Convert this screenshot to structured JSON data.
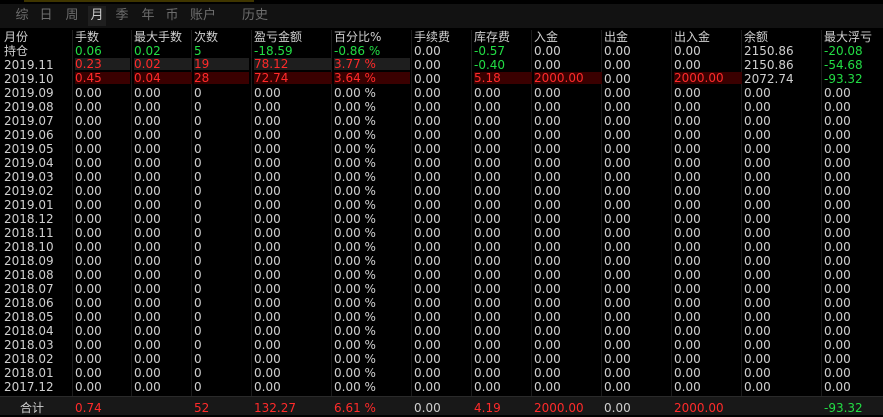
{
  "tabs": [
    {
      "label": "综",
      "active": false
    },
    {
      "label": "日",
      "active": false
    },
    {
      "label": "周",
      "active": false
    },
    {
      "label": "月",
      "active": true
    },
    {
      "label": "季",
      "active": false
    },
    {
      "label": "年",
      "active": false
    },
    {
      "label": "币",
      "active": false
    },
    {
      "label": "账户",
      "active": false
    },
    {
      "label": "历史",
      "active": false
    }
  ],
  "columns": [
    "月份",
    "手数",
    "最大手数",
    "次数",
    "盈亏金额",
    "百分比%",
    "手续费",
    "库存费",
    "入金",
    "出金",
    "出入金",
    "余额",
    "最大浮亏"
  ],
  "colors": {
    "up": "#ff2a2a",
    "down": "#22dd44",
    "neutral": "#d0d0d0",
    "red_bg": "#3a0000",
    "grey_bg": "#1e1e1e"
  },
  "rows": [
    {
      "cells": [
        "持仓",
        "0.06",
        "0.02",
        "5",
        "-18.59",
        "-0.86 %",
        "0.00",
        "-0.57",
        "0.00",
        "0.00",
        "0.00",
        "2150.86",
        "-20.08"
      ],
      "colors": [
        "n",
        "g",
        "g",
        "g",
        "g",
        "g",
        "n",
        "g",
        "n",
        "n",
        "n",
        "n",
        "g"
      ],
      "bars": {}
    },
    {
      "cells": [
        "2019.11",
        "0.23",
        "0.02",
        "19",
        "78.12",
        "3.77 %",
        "0.00",
        "-0.40",
        "0.00",
        "0.00",
        "0.00",
        "2150.86",
        "-54.68"
      ],
      "colors": [
        "n",
        "r",
        "r",
        "r",
        "r",
        "r",
        "n",
        "g",
        "n",
        "n",
        "n",
        "n",
        "g"
      ],
      "bars": {
        "1": "grey",
        "2": "grey",
        "3": "grey",
        "4": "grey",
        "5": "grey"
      }
    },
    {
      "cells": [
        "2019.10",
        "0.45",
        "0.04",
        "28",
        "72.74",
        "3.64 %",
        "0.00",
        "5.18",
        "2000.00",
        "0.00",
        "2000.00",
        "2072.74",
        "-93.32"
      ],
      "colors": [
        "n",
        "r",
        "r",
        "r",
        "r",
        "r",
        "n",
        "r",
        "r",
        "n",
        "r",
        "n",
        "g"
      ],
      "bars": {
        "1": "red",
        "2": "red",
        "3": "red",
        "4": "red",
        "5": "red",
        "7": "red",
        "8": "red",
        "10": "red"
      }
    },
    {
      "cells": [
        "2019.09",
        "0.00",
        "0.00",
        "0",
        "0.00",
        "0.00 %",
        "0.00",
        "0.00",
        "0.00",
        "0.00",
        "0.00",
        "0.00",
        "0.00"
      ]
    },
    {
      "cells": [
        "2019.08",
        "0.00",
        "0.00",
        "0",
        "0.00",
        "0.00 %",
        "0.00",
        "0.00",
        "0.00",
        "0.00",
        "0.00",
        "0.00",
        "0.00"
      ]
    },
    {
      "cells": [
        "2019.07",
        "0.00",
        "0.00",
        "0",
        "0.00",
        "0.00 %",
        "0.00",
        "0.00",
        "0.00",
        "0.00",
        "0.00",
        "0.00",
        "0.00"
      ]
    },
    {
      "cells": [
        "2019.06",
        "0.00",
        "0.00",
        "0",
        "0.00",
        "0.00 %",
        "0.00",
        "0.00",
        "0.00",
        "0.00",
        "0.00",
        "0.00",
        "0.00"
      ]
    },
    {
      "cells": [
        "2019.05",
        "0.00",
        "0.00",
        "0",
        "0.00",
        "0.00 %",
        "0.00",
        "0.00",
        "0.00",
        "0.00",
        "0.00",
        "0.00",
        "0.00"
      ]
    },
    {
      "cells": [
        "2019.04",
        "0.00",
        "0.00",
        "0",
        "0.00",
        "0.00 %",
        "0.00",
        "0.00",
        "0.00",
        "0.00",
        "0.00",
        "0.00",
        "0.00"
      ]
    },
    {
      "cells": [
        "2019.03",
        "0.00",
        "0.00",
        "0",
        "0.00",
        "0.00 %",
        "0.00",
        "0.00",
        "0.00",
        "0.00",
        "0.00",
        "0.00",
        "0.00"
      ]
    },
    {
      "cells": [
        "2019.02",
        "0.00",
        "0.00",
        "0",
        "0.00",
        "0.00 %",
        "0.00",
        "0.00",
        "0.00",
        "0.00",
        "0.00",
        "0.00",
        "0.00"
      ]
    },
    {
      "cells": [
        "2019.01",
        "0.00",
        "0.00",
        "0",
        "0.00",
        "0.00 %",
        "0.00",
        "0.00",
        "0.00",
        "0.00",
        "0.00",
        "0.00",
        "0.00"
      ]
    },
    {
      "cells": [
        "2018.12",
        "0.00",
        "0.00",
        "0",
        "0.00",
        "0.00 %",
        "0.00",
        "0.00",
        "0.00",
        "0.00",
        "0.00",
        "0.00",
        "0.00"
      ]
    },
    {
      "cells": [
        "2018.11",
        "0.00",
        "0.00",
        "0",
        "0.00",
        "0.00 %",
        "0.00",
        "0.00",
        "0.00",
        "0.00",
        "0.00",
        "0.00",
        "0.00"
      ]
    },
    {
      "cells": [
        "2018.10",
        "0.00",
        "0.00",
        "0",
        "0.00",
        "0.00 %",
        "0.00",
        "0.00",
        "0.00",
        "0.00",
        "0.00",
        "0.00",
        "0.00"
      ]
    },
    {
      "cells": [
        "2018.09",
        "0.00",
        "0.00",
        "0",
        "0.00",
        "0.00 %",
        "0.00",
        "0.00",
        "0.00",
        "0.00",
        "0.00",
        "0.00",
        "0.00"
      ]
    },
    {
      "cells": [
        "2018.08",
        "0.00",
        "0.00",
        "0",
        "0.00",
        "0.00 %",
        "0.00",
        "0.00",
        "0.00",
        "0.00",
        "0.00",
        "0.00",
        "0.00"
      ]
    },
    {
      "cells": [
        "2018.07",
        "0.00",
        "0.00",
        "0",
        "0.00",
        "0.00 %",
        "0.00",
        "0.00",
        "0.00",
        "0.00",
        "0.00",
        "0.00",
        "0.00"
      ]
    },
    {
      "cells": [
        "2018.06",
        "0.00",
        "0.00",
        "0",
        "0.00",
        "0.00 %",
        "0.00",
        "0.00",
        "0.00",
        "0.00",
        "0.00",
        "0.00",
        "0.00"
      ]
    },
    {
      "cells": [
        "2018.05",
        "0.00",
        "0.00",
        "0",
        "0.00",
        "0.00 %",
        "0.00",
        "0.00",
        "0.00",
        "0.00",
        "0.00",
        "0.00",
        "0.00"
      ]
    },
    {
      "cells": [
        "2018.04",
        "0.00",
        "0.00",
        "0",
        "0.00",
        "0.00 %",
        "0.00",
        "0.00",
        "0.00",
        "0.00",
        "0.00",
        "0.00",
        "0.00"
      ]
    },
    {
      "cells": [
        "2018.03",
        "0.00",
        "0.00",
        "0",
        "0.00",
        "0.00 %",
        "0.00",
        "0.00",
        "0.00",
        "0.00",
        "0.00",
        "0.00",
        "0.00"
      ]
    },
    {
      "cells": [
        "2018.02",
        "0.00",
        "0.00",
        "0",
        "0.00",
        "0.00 %",
        "0.00",
        "0.00",
        "0.00",
        "0.00",
        "0.00",
        "0.00",
        "0.00"
      ]
    },
    {
      "cells": [
        "2018.01",
        "0.00",
        "0.00",
        "0",
        "0.00",
        "0.00 %",
        "0.00",
        "0.00",
        "0.00",
        "0.00",
        "0.00",
        "0.00",
        "0.00"
      ]
    },
    {
      "cells": [
        "2017.12",
        "0.00",
        "0.00",
        "0",
        "0.00",
        "0.00 %",
        "0.00",
        "0.00",
        "0.00",
        "0.00",
        "0.00",
        "0.00",
        "0.00"
      ]
    }
  ],
  "total": {
    "cells": [
      "合计",
      "0.74",
      "",
      "52",
      "132.27",
      "6.61 %",
      "0.00",
      "4.19",
      "2000.00",
      "0.00",
      "2000.00",
      "",
      "-93.32"
    ],
    "colors": [
      "n",
      "r",
      "n",
      "r",
      "r",
      "r",
      "n",
      "r",
      "r",
      "n",
      "r",
      "n",
      "g"
    ]
  }
}
